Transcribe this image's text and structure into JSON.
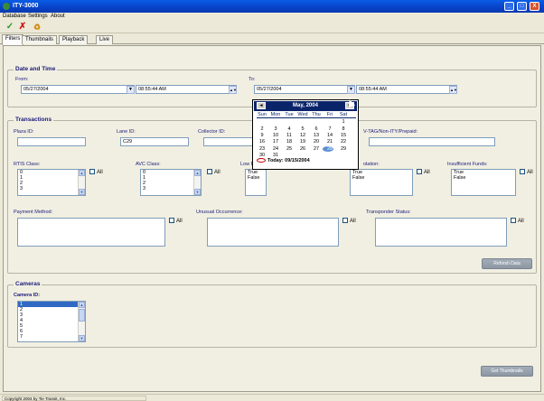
{
  "window": {
    "title": "ITY-3000",
    "controls": [
      "_",
      "□",
      "X"
    ]
  },
  "menu": [
    "Database",
    "Settings",
    "About"
  ],
  "toolbar": {
    "icons": [
      "checkmark-icon",
      "delete-x-icon",
      "refresh-icon"
    ]
  },
  "tabs": [
    {
      "label": "Filters",
      "active": true
    },
    {
      "label": "Thumbnails",
      "active": false
    },
    {
      "label": "Playback",
      "active": false
    },
    {
      "label": "Live",
      "active": false
    }
  ],
  "datetime": {
    "legend": "Date and Time",
    "from_label": "From:",
    "from_date": "05/27/2004",
    "from_time": "08:55:44 AM",
    "to_label": "To:",
    "to_date": "05/27/2004",
    "to_time": "08:55:44 AM"
  },
  "calendar": {
    "month_label": "May, 2004",
    "prev": "◄",
    "next": "►",
    "dow": [
      "Sun",
      "Mon",
      "Tue",
      "Wed",
      "Thu",
      "Fri",
      "Sat"
    ],
    "weeks": [
      [
        "",
        "",
        "",
        "",
        "",
        "",
        "1"
      ],
      [
        "2",
        "3",
        "4",
        "5",
        "6",
        "7",
        "8"
      ],
      [
        "9",
        "10",
        "11",
        "12",
        "13",
        "14",
        "15"
      ],
      [
        "16",
        "17",
        "18",
        "19",
        "20",
        "21",
        "22"
      ],
      [
        "23",
        "24",
        "25",
        "26",
        "27",
        "28",
        "29"
      ],
      [
        "30",
        "31",
        "",
        "",
        "",
        "",
        ""
      ]
    ],
    "today_text": "Today: 09/15/2004"
  },
  "transactions": {
    "legend": "Transactions",
    "plaza_label": "Plaza ID:",
    "plaza_value": "",
    "lane_label": "Lane ID:",
    "lane_value": "C29",
    "collector_label": "Collector ID:",
    "collector_value": "",
    "vtag_label": "V-TAG/Non-ITY/Prepaid:",
    "vtag_value": "",
    "rtis_label": "RTIS Class:",
    "rtis_items": [
      "0",
      "1",
      "2",
      "3"
    ],
    "avc_label": "AVC Class:",
    "avc_items": [
      "0",
      "1",
      "2",
      "3"
    ],
    "lowbal_label": "Low B",
    "lowbal_items": [
      "True",
      "False"
    ],
    "violation_label": "olation:",
    "violation_items": [
      "True",
      "False"
    ],
    "insufficient_label": "Insufficient Funds:",
    "insufficient_items": [
      "True",
      "False"
    ],
    "all_label": "All",
    "payment_label": "Payment Method:",
    "unusual_label": "Unusual Occurrence:",
    "transponder_label": "Transponder Status:",
    "refresh_button": "Refresh Data"
  },
  "cameras": {
    "legend": "Cameras",
    "camera_label": "Camera ID:",
    "items": [
      "1",
      "2",
      "3",
      "4",
      "5",
      "6",
      "7"
    ],
    "get_button": "Get Thumbnails"
  },
  "status": {
    "text": "Copyright 2004 by Tie Transit, Inc."
  }
}
